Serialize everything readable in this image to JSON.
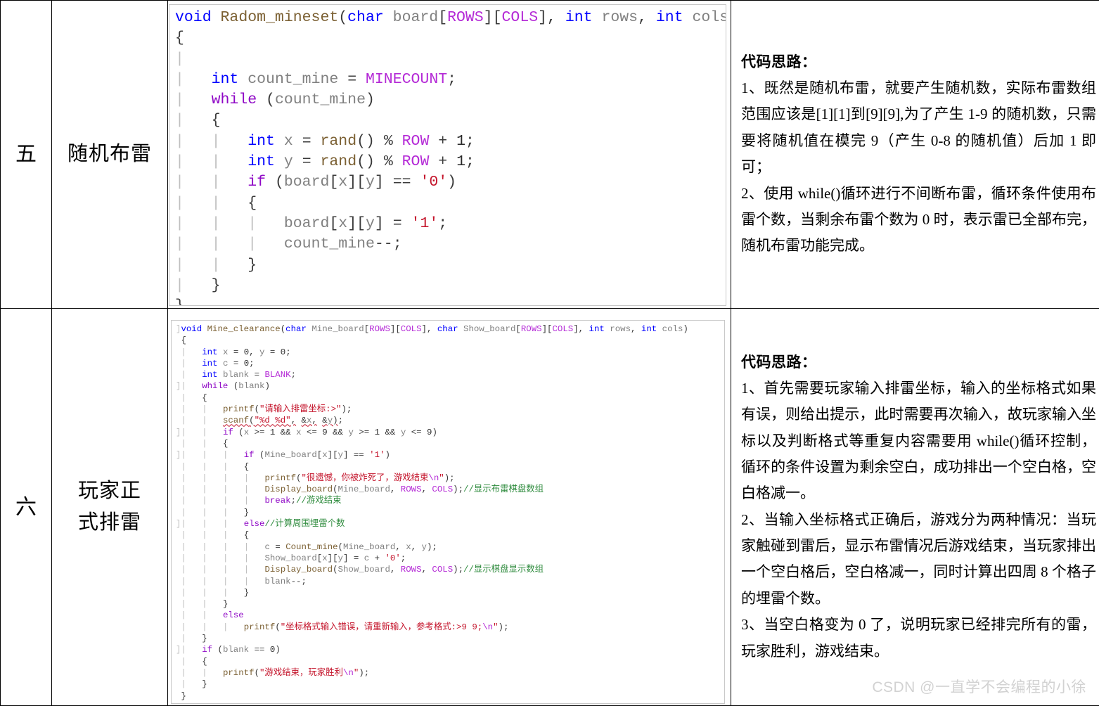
{
  "document": {
    "type": "table",
    "watermark": "CSDN @一直学不会编程的小徐"
  },
  "rows": [
    {
      "index_label": "五",
      "name_label": "随机布雷",
      "code_lines": [
        "void Radom_mineset(char board[ROWS][COLS], int rows, int cols)",
        "{",
        "",
        "    int count_mine = MINECOUNT;",
        "    while (count_mine)",
        "    {",
        "        int x = rand() % ROW + 1;",
        "        int y = rand() % ROW + 1;",
        "        if (board[x][y] == '0')",
        "        {",
        "            board[x][y] = '1';",
        "            count_mine--;",
        "        }",
        "    }",
        "}"
      ],
      "desc_title": "代码思路：",
      "desc_paragraphs": [
        "1、既然是随机布雷，就要产生随机数，实际布雷数组范围应该是[1][1]到[9][9],为了产生 1-9 的随机数，只需要将随机值在模完 9（产生 0-8 的随机值）后加 1 即可；",
        "2、使用 while()循环进行不间断布雷，循环条件使用布雷个数，当剩余布雷个数为 0 时，表示雷已全部布完，随机布雷功能完成。"
      ]
    },
    {
      "index_label": "六",
      "name_label": "玩家正\n式排雷",
      "code_lines": [
        "void Mine_clearance(char Mine_board[ROWS][COLS], char Show_board[ROWS][COLS], int rows, int cols)",
        "{",
        "    int x = 0, y = 0;",
        "    int c = 0;",
        "    int blank = BLANK;",
        "    while (blank)",
        "    {",
        "        printf(\"请输入排雷坐标:>\");",
        "        scanf(\"%d %d\", &x, &y);",
        "        if (x >= 1 && x <= 9 && y >= 1 && y <= 9)",
        "        {",
        "            if (Mine_board[x][y] == '1')",
        "            {",
        "                printf(\"很遗憾，你被炸死了，游戏结束\\n\");",
        "                Display_board(Mine_board, ROWS, COLS);//显示布雷棋盘数组",
        "                break;//游戏结束",
        "            }",
        "            else//计算周围埋雷个数",
        "            {",
        "                c = Count_mine(Mine_board, x, y);",
        "                Show_board[x][y] = c + '0';",
        "                Display_board(Show_board, ROWS, COLS);//显示棋盘显示数组",
        "                blank--;",
        "            }",
        "        }",
        "        else",
        "            printf(\"坐标格式输入错误，请重新输入，参考格式:>9 9;\\n\");",
        "    }",
        "    if (blank == 0)",
        "    {",
        "        printf(\"游戏结束，玩家胜利\\n\");",
        "    }",
        "}"
      ],
      "desc_title": "代码思路：",
      "desc_paragraphs": [
        "1、首先需要玩家输入排雷坐标，输入的坐标格式如果有误，则给出提示，此时需要再次输入，故玩家输入坐标以及判断格式等重复内容需要用 while()循环控制，循环的条件设置为剩余空白，成功排出一个空白格，空白格减一。",
        "2、当输入坐标格式正确后，游戏分为两种情况：当玩家触碰到雷后，显示布雷情况后游戏结束，当玩家排出一个空白格后，空白格减一，同时计算出四周 8 个格子的埋雷个数。",
        "3、当空白格变为 0 了，说明玩家已经排完所有的雷，玩家胜利，游戏结束。"
      ]
    }
  ],
  "colors": {
    "keyword": "#0000ff",
    "control_keyword": "#8f08c6",
    "function": "#7b6033",
    "identifier": "#808080",
    "macro": "#b429d6",
    "string": "#c4142b",
    "comment": "#2e8b3d",
    "border": "#000000",
    "watermark": "#d2d2d2"
  }
}
